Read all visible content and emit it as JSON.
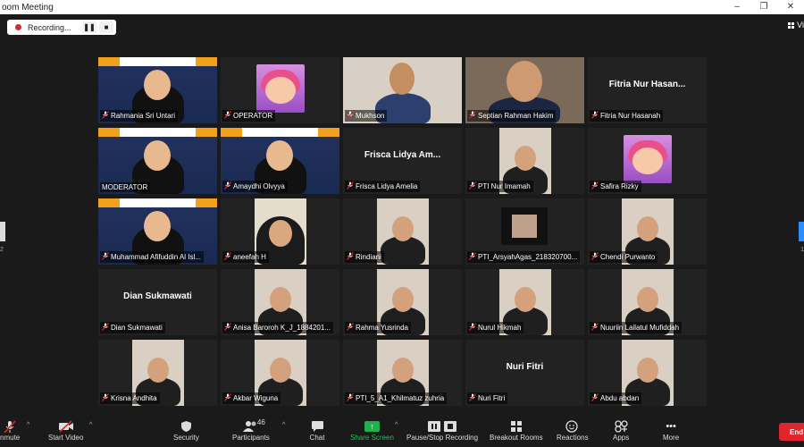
{
  "window": {
    "title": "oom Meeting",
    "controls": [
      "–",
      "❐",
      "✕"
    ]
  },
  "recording": {
    "label": "Recording...",
    "pause_icon": "pause-icon",
    "stop_icon": "stop-icon"
  },
  "view": {
    "label": "Vi",
    "icon": "grid-view-icon"
  },
  "pager": {
    "left": "2",
    "right": "1"
  },
  "participants": [
    {
      "name": "Rahmania Sri Untari",
      "muted": true,
      "kind": "blue-person"
    },
    {
      "name": "OPERATOR",
      "muted": true,
      "kind": "masha"
    },
    {
      "name": "Mukhson",
      "muted": true,
      "kind": "wall-person"
    },
    {
      "name": "Septian Rahman Hakim",
      "muted": true,
      "kind": "room-person"
    },
    {
      "name": "Fitria Nur Hasanah",
      "display": "Fitria Nur Hasan...",
      "muted": true,
      "kind": "text"
    },
    {
      "name": "MODERATOR",
      "muted": false,
      "kind": "blue-person",
      "speaker": true
    },
    {
      "name": "Amaydhi Olvyya",
      "muted": true,
      "kind": "blue-person"
    },
    {
      "name": "Frisca Lidya Amelia",
      "display": "Frisca Lidya Am...",
      "muted": true,
      "kind": "text"
    },
    {
      "name": "PTI Nur Imamah",
      "muted": true,
      "kind": "inner-cam"
    },
    {
      "name": "Safira Rizky",
      "muted": true,
      "kind": "masha"
    },
    {
      "name": "Muhammad Afifuddin Al Isl...",
      "muted": true,
      "kind": "blue-person"
    },
    {
      "name": "aneefah H",
      "muted": true,
      "kind": "cream-person"
    },
    {
      "name": "Rindiani",
      "muted": true,
      "kind": "inner-cam"
    },
    {
      "name": "PTI_ArsyahAgas_218320700...",
      "muted": true,
      "kind": "small-cam"
    },
    {
      "name": "Chendi Purwanto",
      "muted": true,
      "kind": "inner-cam"
    },
    {
      "name": "Dian Sukmawati",
      "display": "Dian Sukmawati",
      "muted": true,
      "kind": "text"
    },
    {
      "name": "Anisa Baroroh K_J_1884201...",
      "muted": true,
      "kind": "inner-cam"
    },
    {
      "name": "Rahma Yusrinda",
      "muted": true,
      "kind": "inner-cam"
    },
    {
      "name": "Nurul Hikmah",
      "muted": true,
      "kind": "inner-cam"
    },
    {
      "name": "Nuuriin Lailatul Mufiddah",
      "muted": true,
      "kind": "inner-cam"
    },
    {
      "name": "Krisna Andhita",
      "muted": true,
      "kind": "inner-cam"
    },
    {
      "name": "Akbar Wiguna",
      "muted": true,
      "kind": "inner-cam"
    },
    {
      "name": "PTI_5_A1_Khilmatuz zuhria",
      "muted": true,
      "kind": "inner-cam"
    },
    {
      "name": "Nuri Fitri",
      "display": "Nuri Fitri",
      "muted": true,
      "kind": "text"
    },
    {
      "name": "Abdu abdan",
      "muted": true,
      "kind": "inner-cam"
    }
  ],
  "toolbar": {
    "unmute": "nmute",
    "start_video": "Start Video",
    "security": "Security",
    "participants": "Participants",
    "participants_count": "46",
    "chat": "Chat",
    "share_screen": "Share Screen",
    "pause_stop_recording": "Pause/Stop Recording",
    "breakout_rooms": "Breakout Rooms",
    "reactions": "Reactions",
    "apps": "Apps",
    "more": "More",
    "end": "End"
  }
}
